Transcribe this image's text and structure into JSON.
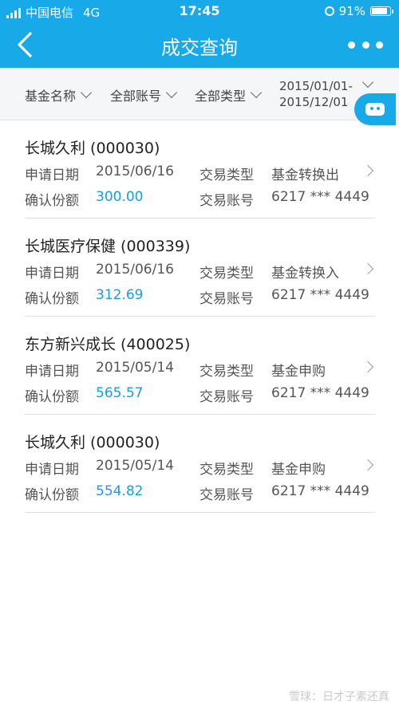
{
  "status_bar": {
    "carrier": "中国电信",
    "network": "4G",
    "time": "17:45",
    "battery": "91%",
    "battery_level": 0.91
  },
  "nav": {
    "title": "成交查询",
    "back_icon": "chevron-left-icon",
    "more_icon": "more-icon"
  },
  "filters": {
    "fund_name": "基金名称",
    "account": "全部账号",
    "type": "全部类型",
    "date_line1": "2015/01/01-",
    "date_line2": "2015/12/01"
  },
  "labels": {
    "apply_date": "申请日期",
    "trade_type": "交易类型",
    "confirm_shares": "确认份额",
    "trade_account": "交易账号"
  },
  "records": [
    {
      "name": "长城久利 (000030)",
      "apply_date": "2015/06/16",
      "trade_type": "基金转换出",
      "shares": "300.00",
      "account": "6217 *** 4449"
    },
    {
      "name": "长城医疗保健 (000339)",
      "apply_date": "2015/06/16",
      "trade_type": "基金转换入",
      "shares": "312.69",
      "account": "6217 *** 4449"
    },
    {
      "name": "东方新兴成长 (400025)",
      "apply_date": "2015/05/14",
      "trade_type": "基金申购",
      "shares": "565.57",
      "account": "6217 *** 4449"
    },
    {
      "name": "长城久利 (000030)",
      "apply_date": "2015/05/14",
      "trade_type": "基金申购",
      "shares": "554.82",
      "account": "6217 *** 4449"
    }
  ],
  "watermark": "雪球：日才子素还真",
  "colors": {
    "primary": "#17a9e8",
    "value_blue": "#17a0d8"
  }
}
